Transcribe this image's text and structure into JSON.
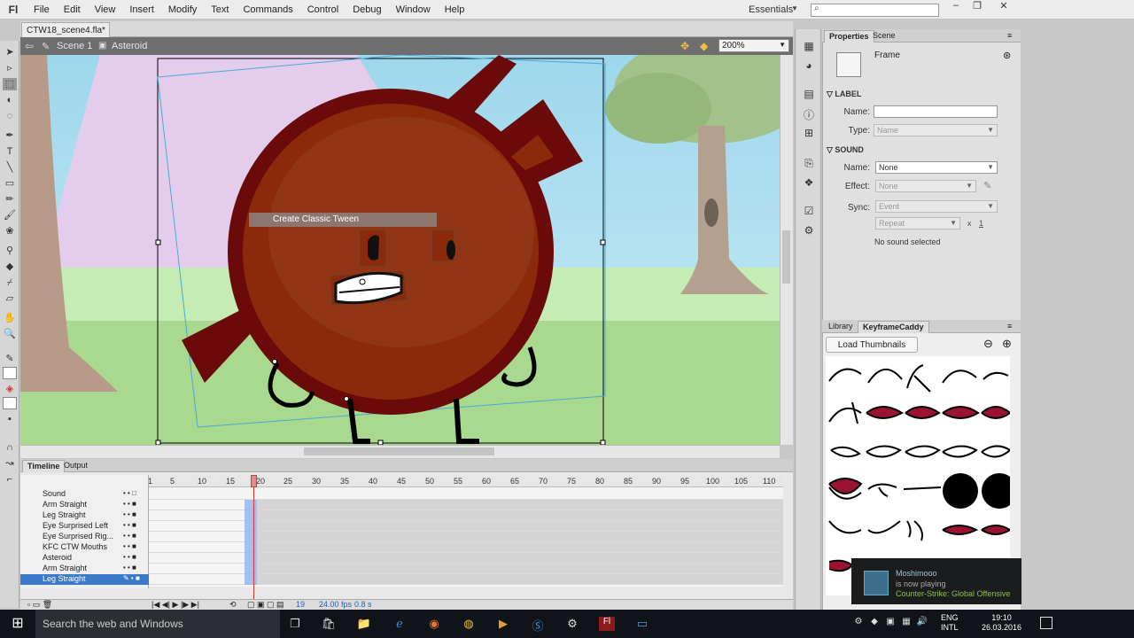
{
  "app": {
    "logo": "Fl",
    "workspace": "Essentials"
  },
  "menu": [
    "File",
    "Edit",
    "View",
    "Insert",
    "Modify",
    "Text",
    "Commands",
    "Control",
    "Debug",
    "Window",
    "Help"
  ],
  "document": {
    "tab": "CTW18_scene4.fla*",
    "scene": "Scene 1",
    "symbol": "Asteroid",
    "zoom": "200%"
  },
  "stage": {
    "context_menu_item": "Create Classic Tween"
  },
  "properties": {
    "tabs": [
      "Properties",
      "Scene"
    ],
    "type_label": "Frame",
    "label_section": "LABEL",
    "name_label": "Name:",
    "type_field_label": "Type:",
    "type_value": "Name",
    "sound_section": "SOUND",
    "sound_name_label": "Name:",
    "sound_name_value": "None",
    "effect_label": "Effect:",
    "effect_value": "None",
    "sync_label": "Sync:",
    "sync_value": "Event",
    "repeat_value": "Repeat",
    "repeat_x": "x",
    "repeat_count": "1",
    "no_sound": "No sound selected"
  },
  "library": {
    "tabs": [
      "Library",
      "KeyframeCaddy"
    ],
    "load_button": "Load Thumbnails"
  },
  "timeline": {
    "tabs": [
      "Timeline",
      "Output"
    ],
    "ruler": [
      "1",
      "5",
      "10",
      "15",
      "20",
      "25",
      "30",
      "35",
      "40",
      "45",
      "50",
      "55",
      "60",
      "65",
      "70",
      "75",
      "80",
      "85",
      "90",
      "95",
      "100",
      "105",
      "110"
    ],
    "layers": [
      "Sound",
      "Arm Straight",
      "Leg Straight",
      "Eye Surprised Left",
      "Eye Surprised Rig...",
      "KFC CTW Mouths",
      "Asteroid",
      "Arm Straight",
      "Leg Straight"
    ],
    "current_frame": "19",
    "fps": "24.00 fps",
    "time": "0.8 s"
  },
  "toast": {
    "name": "Moshimooo",
    "status": "is now playing",
    "game": "Counter-Strike: Global Offensive"
  },
  "taskbar": {
    "search": "Search the web and Windows",
    "lang_1": "ENG",
    "lang_2": "INTL",
    "time": "19:10",
    "date": "26.03.2016"
  }
}
